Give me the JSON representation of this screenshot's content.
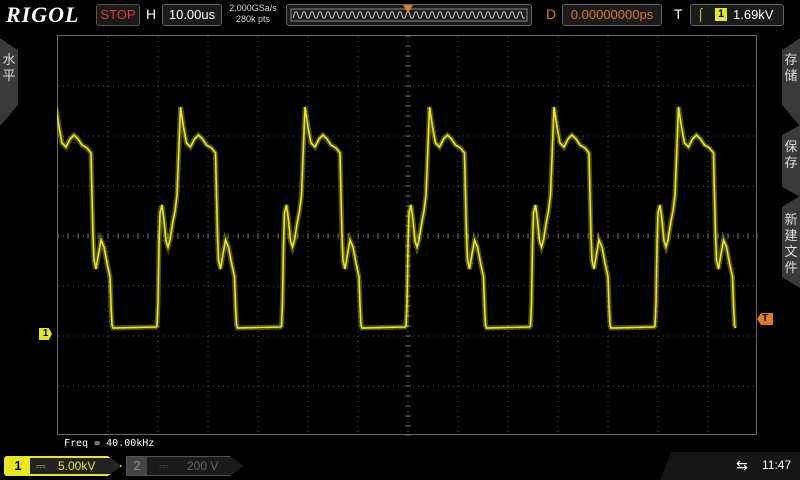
{
  "header": {
    "brand": "RIGOL",
    "run_state": "STOP",
    "horizontal_label": "H",
    "timebase": "10.00us",
    "sample_rate": "2.000GSa/s",
    "memory_depth": "280k pts",
    "delay_label": "D",
    "delay_value": "0.00000000ps",
    "trigger_label": "T",
    "trigger_source": "1",
    "trigger_level": "1.69kV"
  },
  "left_menu": {
    "label": "水平"
  },
  "right_menu": {
    "items": [
      {
        "label": "存储"
      },
      {
        "label": "保存"
      },
      {
        "label": "新建文件"
      }
    ]
  },
  "markers": {
    "ch1": "1",
    "trigger": "T"
  },
  "measurement": {
    "freq": "Freq = 40.00kHz"
  },
  "channels": [
    {
      "number": "1",
      "coupling": "⎓",
      "scale": "5.00kV",
      "active": true,
      "color": "#e8e820"
    },
    {
      "number": "2",
      "coupling": "⎓",
      "scale": "200 V",
      "active": false,
      "color": "#666666"
    }
  ],
  "status": {
    "usb_icon": "usb-icon",
    "time": "11:47"
  },
  "colors": {
    "ch1": "#e8e820",
    "trigger": "#e07a1c",
    "stop": "#e03a3a"
  }
}
